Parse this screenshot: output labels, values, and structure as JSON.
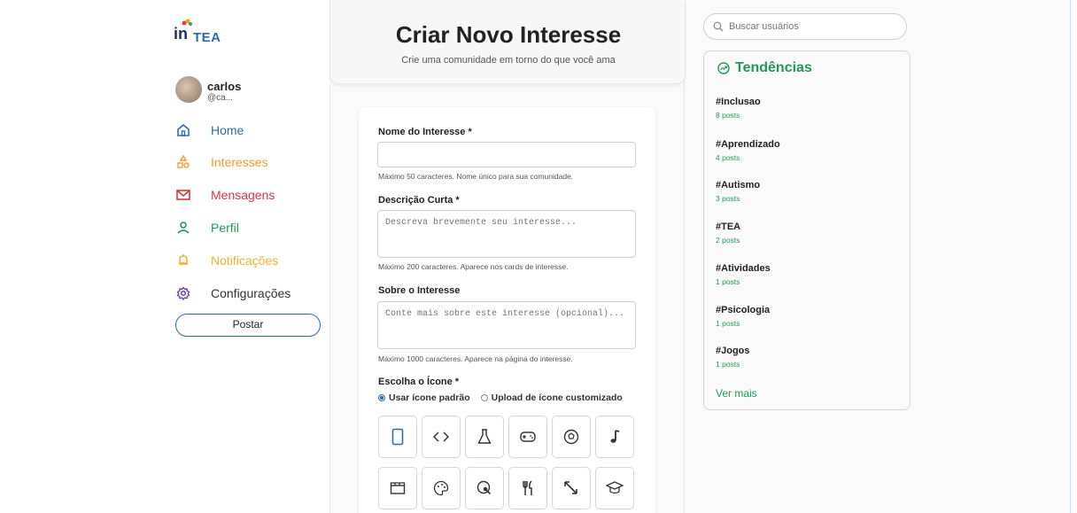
{
  "brand": {
    "logo_prefix": "in",
    "logo_suffix": "TEA"
  },
  "user": {
    "name": "carlos",
    "handle": "@ca..."
  },
  "nav": [
    {
      "label": "Home",
      "icon": "home-icon",
      "color": "#2d6bb0"
    },
    {
      "label": "Interesses",
      "icon": "shapes-icon",
      "color": "#f29a2e"
    },
    {
      "label": "Mensagens",
      "icon": "mail-icon",
      "color": "#d9363e"
    },
    {
      "label": "Perfil",
      "icon": "user-icon",
      "color": "#1f9a56"
    },
    {
      "label": "Notificações",
      "icon": "bell-icon",
      "color": "#f0b429"
    },
    {
      "label": "Configurações",
      "icon": "gear-icon",
      "color": "#6b3fa0"
    }
  ],
  "post_button": "Postar",
  "header": {
    "title": "Criar Novo Interesse",
    "subtitle": "Crie uma comunidade em torno do que você ama"
  },
  "form": {
    "name_label": "Nome do Interesse *",
    "name_value": "",
    "name_help": "Máximo 50 caracteres. Nome único para sua comunidade.",
    "desc_label": "Descrição Curta *",
    "desc_placeholder": "Descreva brevemente seu interesse...",
    "desc_help": "Máximo 200 caracteres. Aparece nos cards de interesse.",
    "about_label": "Sobre o Interesse",
    "about_placeholder": "Conte mais sobre este interesse (opcional)...",
    "about_help": "Máximo 1000 caracteres. Aparece na página do interesse.",
    "icon_label": "Escolha o Ícone *",
    "radio_default": "Usar ícone padrão",
    "radio_custom": "Upload de ícone customizado",
    "radio_selected": "default",
    "icons": [
      "phone-icon",
      "code-icon",
      "flask-icon",
      "gamepad-icon",
      "soccer-ball-icon",
      "music-note-icon",
      "clapperboard-icon",
      "palette-icon",
      "globe-search-icon",
      "utensils-icon",
      "expand-arrows-icon",
      "graduation-cap-icon"
    ],
    "selected_icon": "phone-icon"
  },
  "search": {
    "placeholder": "Buscar usuários"
  },
  "trends": {
    "title": "Tendências",
    "items": [
      {
        "tag": "#Inclusao",
        "count": "8 posts"
      },
      {
        "tag": "#Aprendizado",
        "count": "4 posts"
      },
      {
        "tag": "#Autismo",
        "count": "3 posts"
      },
      {
        "tag": "#TEA",
        "count": "2 posts"
      },
      {
        "tag": "#Atividades",
        "count": "1 posts"
      },
      {
        "tag": "#Psicologia",
        "count": "1 posts"
      },
      {
        "tag": "#Jogos",
        "count": "1 posts"
      }
    ],
    "see_more": "Ver mais"
  },
  "colors": {
    "accent_blue": "#2d6bb0",
    "accent_green": "#1f9a56"
  }
}
